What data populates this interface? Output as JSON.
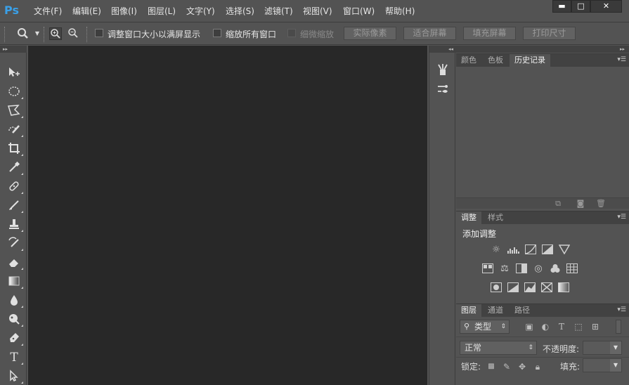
{
  "app": {
    "logo": "Ps"
  },
  "menu": [
    "文件(F)",
    "编辑(E)",
    "图像(I)",
    "图层(L)",
    "文字(Y)",
    "选择(S)",
    "滤镜(T)",
    "视图(V)",
    "窗口(W)",
    "帮助(H)"
  ],
  "window_controls": {
    "minimize": "▬",
    "maximize": "□",
    "close": "✕"
  },
  "options_bar": {
    "resize_windows_label": "调整窗口大小以满屏显示",
    "zoom_all_windows_label": "缩放所有窗口",
    "scrubby_zoom_label": "细微缩放",
    "actual_pixels": "实际像素",
    "fit_screen": "适合屏幕",
    "fill_screen": "填充屏幕",
    "print_size": "打印尺寸"
  },
  "tools": [
    "move-tool-icon",
    "elliptical-marquee-icon",
    "polygonal-lasso-icon",
    "quick-selection-icon",
    "crop-tool-icon",
    "eyedropper-icon",
    "spot-healing-icon",
    "brush-tool-icon",
    "clone-stamp-icon",
    "history-brush-icon",
    "eraser-icon",
    "gradient-icon",
    "blur-icon",
    "dodge-icon",
    "pen-tool-icon",
    "type-tool-icon",
    "path-selection-icon"
  ],
  "panels": {
    "color_group": {
      "tabs": [
        "颜色",
        "色板",
        "历史记录"
      ],
      "active": 2
    },
    "adjustments_group": {
      "tabs": [
        "调整",
        "样式"
      ],
      "active": 0,
      "title": "添加调整"
    },
    "layers_group": {
      "tabs": [
        "图层",
        "通道",
        "路径"
      ],
      "active": 0,
      "filter_kind": "类型",
      "blend_mode": "正常",
      "opacity_label": "不透明度:",
      "lock_label": "锁定:",
      "fill_label": "填充:"
    }
  },
  "colors": {
    "canvas_bg": "#282828",
    "ui_bg": "#535353",
    "accent": "#3aa0e8"
  }
}
